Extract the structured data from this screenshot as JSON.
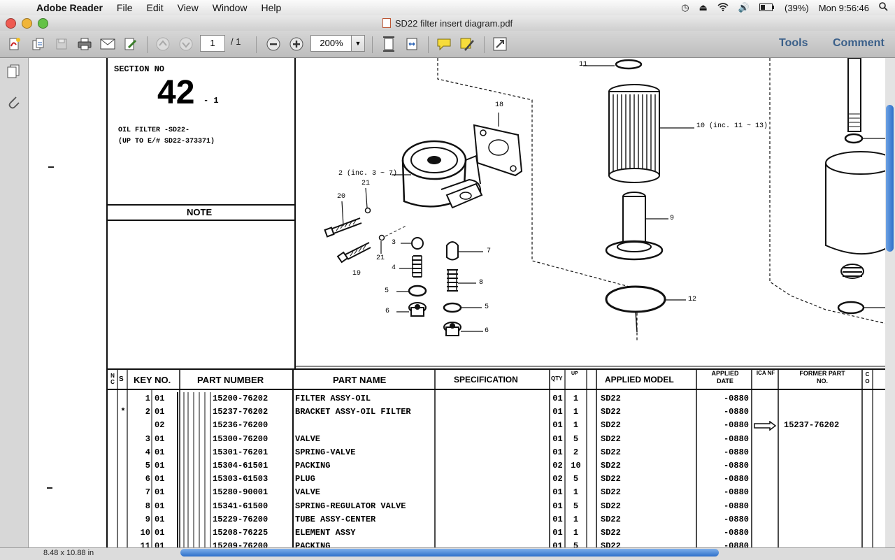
{
  "menubar": {
    "app_name": "Adobe Reader",
    "items": [
      "File",
      "Edit",
      "View",
      "Window",
      "Help"
    ],
    "battery": "(39%)",
    "clock": "Mon 9:56:46"
  },
  "window": {
    "title": "SD22 filter insert diagram.pdf"
  },
  "toolbar": {
    "page_current": "1",
    "page_total": "/ 1",
    "zoom": "200%",
    "tools_label": "Tools",
    "comment_label": "Comment"
  },
  "status": {
    "page_size": "8.48 x 10.88 in"
  },
  "doc": {
    "section_label": "SECTION NO",
    "section_number": "42",
    "section_suffix": "- 1",
    "title_line1": "OIL FILTER -SD22-",
    "title_line2": "(UP TO E/# SD22-373371)",
    "note_label": "NOTE",
    "callouts": {
      "c11": "11",
      "c10": "10 (inc. 11 ~ 13)",
      "c18": "18",
      "c2": "2 (inc. 3 ~ 7)",
      "c21a": "21",
      "c20": "20",
      "c9": "9",
      "c3": "3",
      "c21b": "21",
      "c7": "7",
      "c19": "19",
      "c4": "4",
      "c8": "8",
      "c12": "12",
      "c5a": "5",
      "c5b": "5",
      "c6a": "6",
      "c6b": "6"
    },
    "table": {
      "headers": {
        "nc": "N C",
        "s": "S",
        "key_no": "KEY NO.",
        "part_number": "PART NUMBER",
        "part_name": "PART NAME",
        "spec": "SPECIFICATION",
        "qty": "QTY",
        "up": "UP",
        "applied_model": "APPLIED MODEL",
        "applied_date": "APPLIED DATE",
        "ica": "ICA NF",
        "former": "FORMER PART NO.",
        "co": "C O"
      },
      "rows": [
        {
          "s": "",
          "key": "1",
          "sub": "01",
          "part": "15200-76202",
          "name": "FILTER ASSY-OIL",
          "qty": "01",
          "up": "1",
          "model": "SD22",
          "date": "-0880",
          "arrow": false,
          "former": ""
        },
        {
          "s": "*",
          "key": "2",
          "sub": "01",
          "part": "15237-76202",
          "name": "BRACKET ASSY-OIL FILTER",
          "qty": "01",
          "up": "1",
          "model": "SD22",
          "date": "-0880",
          "arrow": false,
          "former": ""
        },
        {
          "s": "",
          "key": "",
          "sub": "02",
          "part": "15236-76200",
          "name": "",
          "qty": "01",
          "up": "1",
          "model": "SD22",
          "date": "-0880",
          "arrow": true,
          "former": "15237-76202"
        },
        {
          "s": "",
          "key": "3",
          "sub": "01",
          "part": "15300-76200",
          "name": "VALVE",
          "qty": "01",
          "up": "5",
          "model": "SD22",
          "date": "-0880",
          "arrow": false,
          "former": ""
        },
        {
          "s": "",
          "key": "4",
          "sub": "01",
          "part": "15301-76201",
          "name": "SPRING-VALVE",
          "qty": "01",
          "up": "2",
          "model": "SD22",
          "date": "-0880",
          "arrow": false,
          "former": ""
        },
        {
          "s": "",
          "key": "5",
          "sub": "01",
          "part": "15304-61501",
          "name": "PACKING",
          "qty": "02",
          "up": "10",
          "model": "SD22",
          "date": "-0880",
          "arrow": false,
          "former": ""
        },
        {
          "s": "",
          "key": "6",
          "sub": "01",
          "part": "15303-61503",
          "name": "PLUG",
          "qty": "02",
          "up": "5",
          "model": "SD22",
          "date": "-0880",
          "arrow": false,
          "former": ""
        },
        {
          "s": "",
          "key": "7",
          "sub": "01",
          "part": "15280-90001",
          "name": "VALVE",
          "qty": "01",
          "up": "1",
          "model": "SD22",
          "date": "-0880",
          "arrow": false,
          "former": ""
        },
        {
          "s": "",
          "key": "8",
          "sub": "01",
          "part": "15341-61500",
          "name": "SPRING-REGULATOR VALVE",
          "qty": "01",
          "up": "5",
          "model": "SD22",
          "date": "-0880",
          "arrow": false,
          "former": ""
        },
        {
          "s": "",
          "key": "9",
          "sub": "01",
          "part": "15229-76200",
          "name": "TUBE ASSY-CENTER",
          "qty": "01",
          "up": "1",
          "model": "SD22",
          "date": "-0880",
          "arrow": false,
          "former": ""
        },
        {
          "s": "",
          "key": "10",
          "sub": "01",
          "part": "15208-76225",
          "name": "ELEMENT ASSY",
          "qty": "01",
          "up": "1",
          "model": "SD22",
          "date": "-0880",
          "arrow": false,
          "former": ""
        },
        {
          "s": "",
          "key": "11",
          "sub": "01",
          "part": "15209-76200",
          "name": "PACKING",
          "qty": "01",
          "up": "5",
          "model": "SD22",
          "date": "-0880",
          "arrow": false,
          "former": ""
        }
      ]
    }
  }
}
